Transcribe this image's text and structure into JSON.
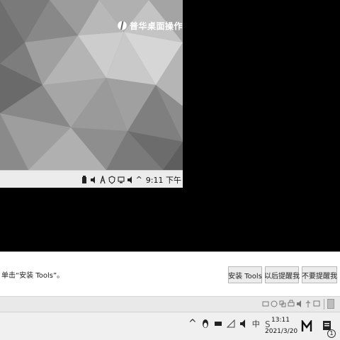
{
  "vm": {
    "brand_text": "普华桌面操作系统",
    "taskbar": {
      "tray_icons": [
        "usb-icon",
        "volume-icon",
        "network-icon",
        "shield-icon",
        "display-icon",
        "speaker-icon"
      ],
      "chevron": "^",
      "clock": "9:11 下午"
    }
  },
  "notification": {
    "message": "单击“安装 Tools”。",
    "buttons": {
      "install": "安装 Tools",
      "later": "以后提醒我",
      "never": "不要提醒我"
    }
  },
  "vm_status_strip": {
    "device_icons": [
      "hdd-icon",
      "cdrom-icon",
      "network-adapter-icon",
      "printer-icon",
      "sound-icon",
      "usb-icon",
      "display-icon"
    ]
  },
  "host": {
    "tray": {
      "chevron": "^",
      "ime": "中"
    },
    "clock": {
      "time": "13:11",
      "date": "2021/3/20"
    },
    "notification_count": "1"
  },
  "colors": {
    "background": "#000000",
    "taskbar": "#ececec",
    "notify_bg": "#ffffff",
    "button_bg": "#ececec"
  }
}
